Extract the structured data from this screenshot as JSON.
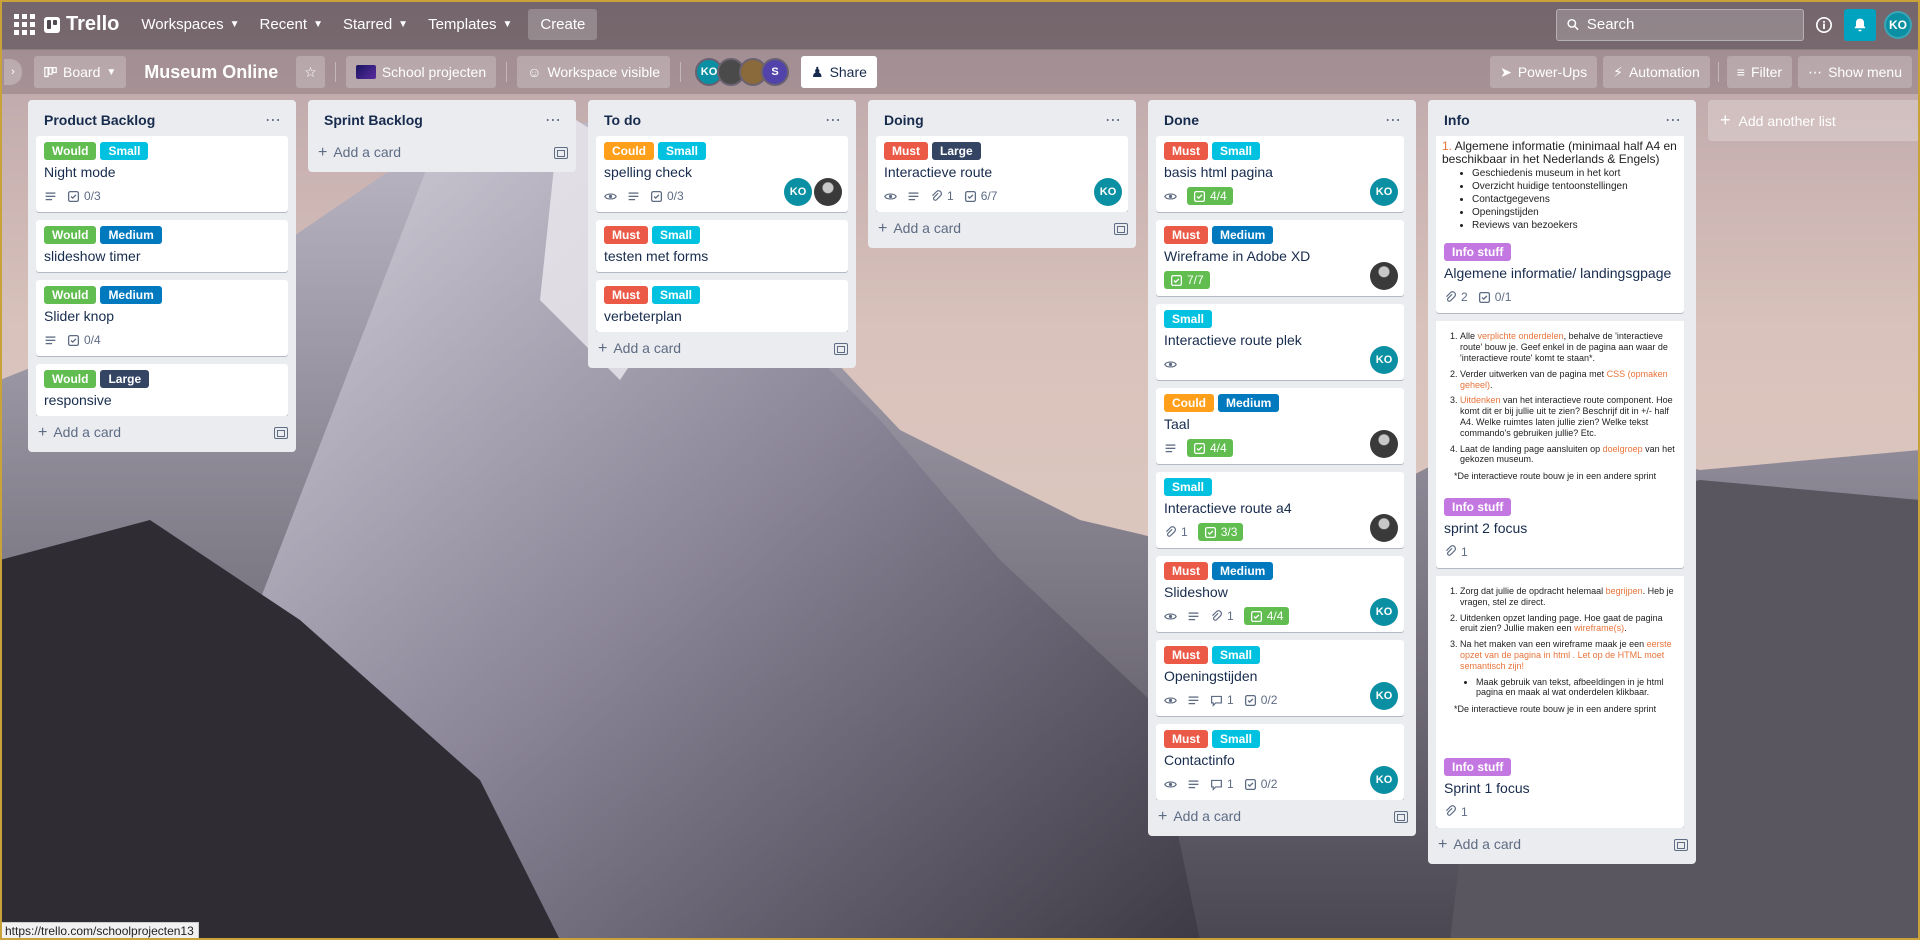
{
  "nav": {
    "logo": "Trello",
    "workspaces": "Workspaces",
    "recent": "Recent",
    "starred": "Starred",
    "templates": "Templates",
    "create": "Create",
    "search_placeholder": "Search",
    "user_initials": "KO"
  },
  "board": {
    "view": "Board",
    "title": "Museum Online",
    "workspace": "School projecten",
    "visibility": "Workspace visible",
    "members": [
      {
        "initials": "KO",
        "color": "#0a8fa3"
      },
      {
        "initials": "",
        "color": "#4a4a4a"
      },
      {
        "initials": "",
        "color": "#8a6a3a"
      },
      {
        "initials": "S",
        "color": "#5243aa"
      }
    ],
    "share": "Share",
    "powerups": "Power-Ups",
    "automation": "Automation",
    "filter": "Filter",
    "show_menu": "Show menu"
  },
  "lists": [
    {
      "title": "Product Backlog",
      "add_card": "Add a card",
      "cards": [
        {
          "labels": [
            {
              "text": "Would",
              "color": "green"
            },
            {
              "text": "Small",
              "color": "sky"
            }
          ],
          "title": "Night mode",
          "desc": true,
          "checklist": "0/3"
        },
        {
          "labels": [
            {
              "text": "Would",
              "color": "green"
            },
            {
              "text": "Medium",
              "color": "blue"
            }
          ],
          "title": "slideshow timer"
        },
        {
          "labels": [
            {
              "text": "Would",
              "color": "green"
            },
            {
              "text": "Medium",
              "color": "blue"
            }
          ],
          "title": "Slider knop",
          "desc": true,
          "checklist": "0/4"
        },
        {
          "labels": [
            {
              "text": "Would",
              "color": "green"
            },
            {
              "text": "Large",
              "color": "navy"
            }
          ],
          "title": "responsive"
        }
      ]
    },
    {
      "title": "Sprint Backlog",
      "add_card": "Add a card",
      "cards": []
    },
    {
      "title": "To do",
      "add_card": "Add a card",
      "cards": [
        {
          "labels": [
            {
              "text": "Could",
              "color": "orange"
            },
            {
              "text": "Small",
              "color": "sky"
            }
          ],
          "title": "spelling check",
          "watch": true,
          "desc": true,
          "checklist": "0/3",
          "members": [
            "KO",
            "ph"
          ]
        },
        {
          "labels": [
            {
              "text": "Must",
              "color": "red"
            },
            {
              "text": "Small",
              "color": "sky"
            }
          ],
          "title": "testen met forms"
        },
        {
          "labels": [
            {
              "text": "Must",
              "color": "red"
            },
            {
              "text": "Small",
              "color": "sky"
            }
          ],
          "title": "verbeterplan"
        }
      ]
    },
    {
      "title": "Doing",
      "add_card": "Add a card",
      "cards": [
        {
          "labels": [
            {
              "text": "Must",
              "color": "red"
            },
            {
              "text": "Large",
              "color": "navy"
            }
          ],
          "title": "Interactieve route",
          "watch": true,
          "desc": true,
          "attachments": "1",
          "checklist": "6/7",
          "members": [
            "KO"
          ]
        }
      ]
    },
    {
      "title": "Done",
      "add_card": "Add a card",
      "cards": [
        {
          "labels": [
            {
              "text": "Must",
              "color": "red"
            },
            {
              "text": "Small",
              "color": "sky"
            }
          ],
          "title": "basis html pagina",
          "watch": true,
          "checklist_done": "4/4",
          "members": [
            "KO"
          ]
        },
        {
          "labels": [
            {
              "text": "Must",
              "color": "red"
            },
            {
              "text": "Medium",
              "color": "blue"
            }
          ],
          "title": "Wireframe in Adobe XD",
          "checklist_done": "7/7",
          "members": [
            "ph"
          ]
        },
        {
          "labels": [
            {
              "text": "Small",
              "color": "sky"
            }
          ],
          "title": "Interactieve route plek",
          "watch": true,
          "members": [
            "KO"
          ]
        },
        {
          "labels": [
            {
              "text": "Could",
              "color": "orange"
            },
            {
              "text": "Medium",
              "color": "blue"
            }
          ],
          "title": "Taal",
          "desc": true,
          "checklist_done": "4/4",
          "members": [
            "ph"
          ]
        },
        {
          "labels": [
            {
              "text": "Small",
              "color": "sky"
            }
          ],
          "title": "Interactieve route a4",
          "attachments": "1",
          "checklist_done": "3/3",
          "members": [
            "ph"
          ]
        },
        {
          "labels": [
            {
              "text": "Must",
              "color": "red"
            },
            {
              "text": "Medium",
              "color": "blue"
            }
          ],
          "title": "Slideshow",
          "watch": true,
          "desc": true,
          "attachments": "1",
          "checklist_done": "4/4",
          "members": [
            "KO"
          ]
        },
        {
          "labels": [
            {
              "text": "Must",
              "color": "red"
            },
            {
              "text": "Small",
              "color": "sky"
            }
          ],
          "title": "Openingstijden",
          "watch": true,
          "desc": true,
          "comments": "1",
          "checklist": "0/2",
          "members": [
            "KO"
          ]
        },
        {
          "labels": [
            {
              "text": "Must",
              "color": "red"
            },
            {
              "text": "Small",
              "color": "sky"
            }
          ],
          "title": "Contactinfo",
          "watch": true,
          "desc": true,
          "comments": "1",
          "checklist": "0/2",
          "members": [
            "KO"
          ]
        }
      ]
    },
    {
      "title": "Info",
      "add_card": "Add a card",
      "cards": [
        {
          "cover": "c1",
          "labels": [
            {
              "text": "Info stuff",
              "color": "purple"
            }
          ],
          "title": "Algemene informatie/ landingsgpage",
          "attachments": "2",
          "checklist": "0/1"
        },
        {
          "cover": "c2",
          "labels": [
            {
              "text": "Info stuff",
              "color": "purple"
            }
          ],
          "title": "sprint 2 focus",
          "attachments": "1"
        },
        {
          "cover": "c3",
          "labels": [
            {
              "text": "Info stuff",
              "color": "purple"
            }
          ],
          "title": "Sprint 1 focus",
          "attachments": "1"
        }
      ]
    }
  ],
  "covers": {
    "c1": {
      "heading_num": "1.",
      "heading": "Algemene informatie (minimaal half A4 en beschikbaar in het Nederlands & Engels)",
      "bullets": [
        "Geschiedenis museum in het kort",
        "Overzicht huidige tentoonstellingen",
        "Contactgegevens",
        "Openingstijden",
        "Reviews van bezoekers"
      ]
    },
    "c2": {
      "items": [
        [
          "Alle ",
          "verplichte onderdelen",
          ", behalve de 'interactieve route' bouw je. Geef enkel in de pagina aan waar de 'interactieve route' komt te staan*."
        ],
        [
          "Verder uitwerken van de pagina met ",
          "CSS (opmaken geheel)",
          "."
        ],
        [
          "",
          "Uitdenken",
          " van het interactieve route component. Hoe komt dit er bij jullie uit te zien? Beschrijf dit in +/- half A4. Welke ruimtes laten jullie zien? Welke tekst commando's gebruiken jullie? Etc."
        ],
        [
          "Laat de landing page aansluiten op ",
          "doelgroep",
          " van het gekozen museum."
        ]
      ],
      "note": "*De interactieve route bouw je in een andere sprint"
    },
    "c3": {
      "items": [
        [
          "Zorg dat jullie de opdracht helemaal ",
          "begrijpen",
          ". Heb je vragen, stel ze direct."
        ],
        [
          "Uitdenken opzet landing page. Hoe gaat de pagina eruit zien? Jullie maken een ",
          "wireframe(s)",
          "."
        ],
        [
          "Na het maken van een wireframe maak je een ",
          "eerste opzet van de pagina in html . Let op de HTML moet semantisch zijn!",
          ""
        ]
      ],
      "sub": "Maak gebruik van tekst, afbeeldingen in je html pagina en maak al wat onderdelen klikbaar.",
      "note": "*De interactieve route bouw je in een andere sprint"
    }
  },
  "add_list": "Add another list",
  "status_url": "https://trello.com/schoolprojecten13",
  "colors": {
    "green": "#61bd4f",
    "sky": "#00c2e0",
    "orange": "#ff9f1a",
    "red": "#eb5a46",
    "blue": "#0079bf",
    "navy": "#344563",
    "purple": "#c377e0"
  }
}
